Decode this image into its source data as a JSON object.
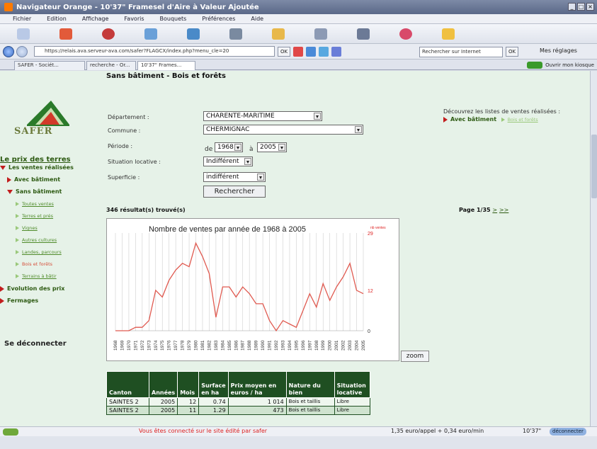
{
  "window": {
    "title": "Navigateur Orange  -  10'37\" Framesel d'Aire à Valeur Ajoutée"
  },
  "menu": [
    "Fichier",
    "Edition",
    "Affichage",
    "Favoris",
    "Bouquets",
    "Préférences",
    "Aide"
  ],
  "address": {
    "url": "https://relais.ava.serveur-ava.com/safer?FLAGCX/index.php?menu_cle=20",
    "ok": "OK",
    "search_placeholder": "Rechercher sur Internet",
    "search_ok": "OK",
    "settings": "Mes réglages"
  },
  "tabs": [
    "SAFER - Sociét...",
    "recherche - Or...",
    "10'37\" Frames..."
  ],
  "kiosque": "Ouvrir mon kiosque",
  "page": {
    "heading": "Sans bâtiment - Bois et forêts",
    "logo": "SAFER",
    "sidebar": {
      "title": "Le prix des terres",
      "ventes": "Les ventes réalisées",
      "avec": "Avec bâtiment",
      "sans": "Sans bâtiment",
      "subs": [
        "Toutes ventes",
        "Terres et prés",
        "Vignes",
        "Autres cultures",
        "Landes, parcours",
        "Bois et forêts",
        "Terrains à bâtir"
      ],
      "evolution": "Evolution des prix",
      "fermages": "Fermages",
      "logout": "Se déconnecter"
    },
    "form": {
      "departement_label": "Département :",
      "departement_value": "CHARENTE-MARITIME",
      "commune_label": "Commune :",
      "commune_value": "CHERMIGNAC",
      "periode_label": "Période :",
      "de": "de",
      "from": "1968",
      "a": "à",
      "to": "2005",
      "situation_label": "Situation locative :",
      "situation_value": "Indifférent",
      "superficie_label": "Superficie :",
      "superficie_value": "indifférent",
      "search_button": "Rechercher"
    },
    "discover": {
      "text": "Découvrez les listes de ventes réalisées :",
      "avec": "Avec bâtiment",
      "current": "Bois et forêts"
    },
    "results": "346 résultat(s) trouvé(s)",
    "pagination": {
      "label": "Page 1/35",
      "next": ">",
      "last": ">>"
    },
    "zoom": "zoom",
    "table": {
      "headers": [
        "Canton",
        "Années",
        "Mois",
        "Surface en ha",
        "Prix moyen en euros / ha",
        "Nature du bien",
        "Situation locative"
      ],
      "rows": [
        [
          "SAINTES 2",
          "2005",
          "12",
          "0.74",
          "1 014",
          "Bois et taillis",
          "Libre"
        ],
        [
          "SAINTES 2",
          "2005",
          "11",
          "1.29",
          "473",
          "Bois et taillis",
          "Libre"
        ]
      ]
    }
  },
  "status": {
    "connected": "Vous êtes connecté sur le site édité par safer",
    "price": "1,35 euro/appel + 0,34 euro/min",
    "time": "10'37\"",
    "disconnect": "déconnecter"
  },
  "colors": {
    "line": "#e05a50",
    "accent_green": "#1f4f22",
    "page_bg": "#e6f2e8"
  },
  "chart_data": {
    "type": "line",
    "title": "Nombre de ventes par année de 1968 à 2005",
    "series_label": "nb ventes",
    "x": [
      "1968",
      "1969",
      "1970",
      "1971",
      "1972",
      "1973",
      "1974",
      "1975",
      "1976",
      "1977",
      "1978",
      "1979",
      "1980",
      "1981",
      "1982",
      "1983",
      "1984",
      "1985",
      "1986",
      "1987",
      "1988",
      "1989",
      "1990",
      "1991",
      "1992",
      "1993",
      "1994",
      "1995",
      "1996",
      "1997",
      "1998",
      "1999",
      "2000",
      "2001",
      "2002",
      "2003",
      "2004",
      "2005"
    ],
    "values": [
      0,
      0,
      0,
      1,
      1,
      3,
      12,
      10,
      15,
      18,
      20,
      19,
      26,
      22,
      17,
      4,
      13,
      13,
      10,
      13,
      11,
      8,
      8,
      3,
      0,
      3,
      2,
      1,
      6,
      11,
      7,
      14,
      9,
      13,
      16,
      20,
      12,
      11
    ],
    "ylim": [
      0,
      29
    ],
    "yticks": [
      0,
      12,
      29
    ],
    "grid": "vertical"
  }
}
